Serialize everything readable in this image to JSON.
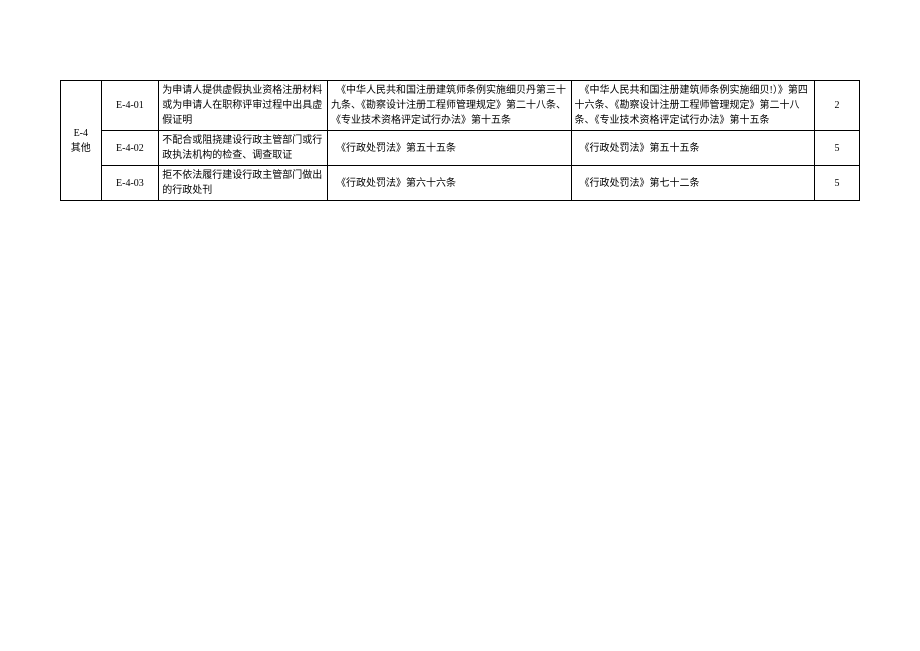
{
  "table": {
    "category": {
      "code": "E-4",
      "label": "其他"
    },
    "rows": [
      {
        "code": "E-4-01",
        "desc": "为申请人提供虚假执业资格注册材料或为申请人在职称评审过程中出具虚假证明",
        "ref1": "　《中华人民共和国注册建筑师条例实施细贝丹第三十九条、《勘察设计注册工程师管理规定》第二十八条、《专业技术资格评定试行办法》第十五条",
        "ref2": "　《中华人民共和国注册建筑师条例实施细贝!）》第四十六条、《勘察设计注册工程师管理规定》第二十八条、《专业技术资格评定试行办法》第十五条",
        "num": "2"
      },
      {
        "code": "E-4-02",
        "desc": "不配合或阻挠建设行政主管部门或行政执法机构的检查、调查取证",
        "ref1": "　《行政处罚法》第五十五条",
        "ref2": "　《行政处罚法》第五十五条",
        "num": "5"
      },
      {
        "code": "E-4-03",
        "desc": "拒不依法履行建设行政主管部门做出的行政处刊",
        "ref1": "　《行政处罚法》第六十六条",
        "ref2": "　《行政处罚法》第七十二条",
        "num": "5"
      }
    ]
  }
}
